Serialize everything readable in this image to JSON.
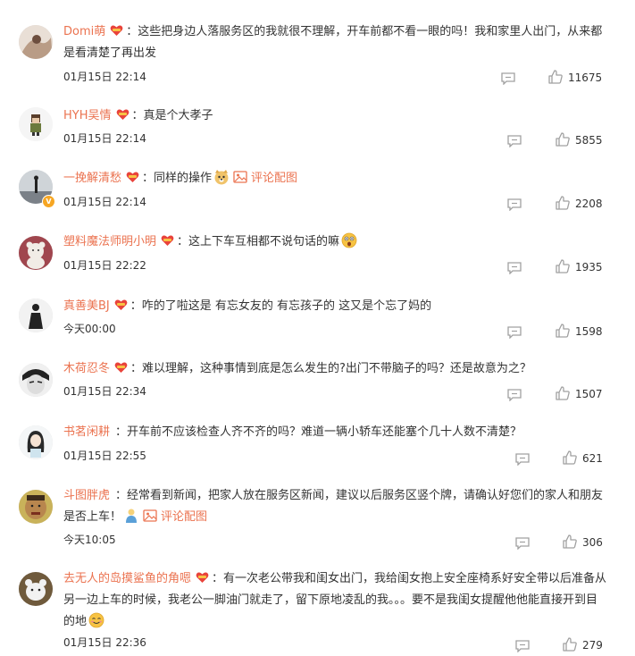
{
  "comments": [
    {
      "user": "Domi萌",
      "text": "：这些把身边人落服务区的我就很不理解，开车前都不看一眼的吗！我和家里人出门，从来都是看清楚了再出发",
      "time": "01月15日 22:14",
      "likes": "11675"
    },
    {
      "user": "HYH吴情",
      "text": "：真是个大孝子",
      "time": "01月15日 22:14",
      "likes": "5855"
    },
    {
      "user": "一挽解清愁",
      "text": "：同样的操作",
      "pic_link": "评论配图",
      "time": "01月15日 22:14",
      "likes": "2208"
    },
    {
      "user": "塑料魔法师明小明",
      "text": "：这上下车互相都不说句话的嘛",
      "time": "01月15日 22:22",
      "likes": "1935"
    },
    {
      "user": "真善美BJ",
      "text": "：咋的了啦这是 有忘女友的 有忘孩子的 这又是个忘了妈的",
      "time": "今天00:00",
      "likes": "1598"
    },
    {
      "user": "木荷忍冬",
      "text": "：难以理解，这种事情到底是怎么发生的?出门不带脑子的吗？还是故意为之？",
      "time": "01月15日 22:34",
      "likes": "1507"
    },
    {
      "user": "书茗闲耕",
      "text": "：开车前不应该检查人齐不齐的吗？难道一辆小轿车还能塞个几十人数不清楚？",
      "time": "01月15日 22:55",
      "likes": "621"
    },
    {
      "user": "斗图胖虎",
      "text": "：经常看到新闻，把家人放在服务区新闻，建议以后服务区竖个牌，请确认好您们的家人和朋友是否上车！",
      "pic_link": "评论配图",
      "time": "今天10:05",
      "likes": "306"
    },
    {
      "user": "去无人的岛摸鲨鱼的角嗯",
      "text": "：有一次老公带我和闺女出门，我给闺女抱上安全座椅系好安全带以后准备从另一边上车的时候，我老公一脚油门就走了，留下原地凌乱的我。。。要不是我闺女提醒他他能直接开到目的地",
      "time": "01月15日 22:36",
      "likes": "279"
    }
  ],
  "colors": {
    "username": "#eb7350",
    "text": "#333333",
    "icon": "#a0a0a0"
  }
}
